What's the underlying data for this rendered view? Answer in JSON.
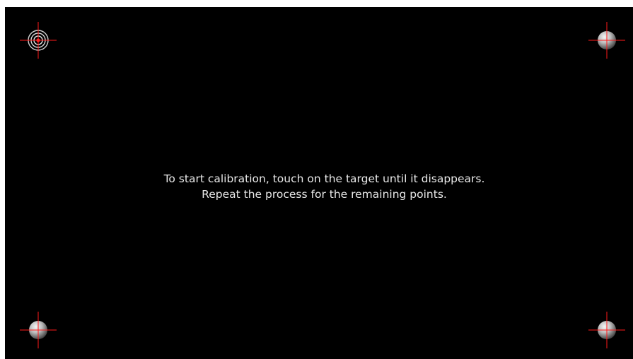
{
  "screen": {
    "background_color": "#000000"
  },
  "instructions": {
    "line1": "To start calibration, touch on the target until it disappears.",
    "line2": "Repeat the process for the remaining points."
  },
  "targets": [
    {
      "position": "top-left",
      "state": "active",
      "icon": "active-target-icon"
    },
    {
      "position": "top-right",
      "state": "pending",
      "icon": "gray-sphere-target-icon"
    },
    {
      "position": "bottom-left",
      "state": "pending",
      "icon": "gray-sphere-target-icon"
    },
    {
      "position": "bottom-right",
      "state": "pending",
      "icon": "gray-sphere-target-icon"
    }
  ],
  "colors": {
    "crosshair": "#ff1a1a",
    "active_center": "#ff2020",
    "sphere_light": "#f2f2f2",
    "sphere_dark": "#3a3a3a"
  }
}
